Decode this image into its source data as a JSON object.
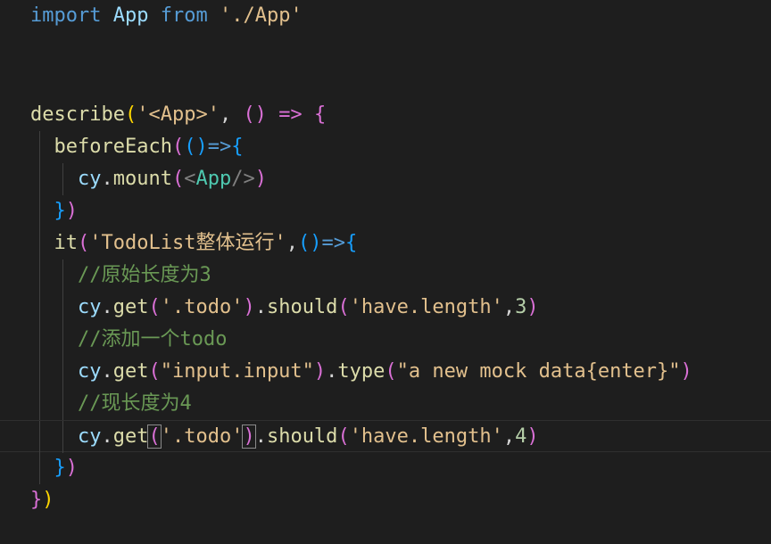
{
  "editor": {
    "lines": [
      {
        "tokens": [
          {
            "t": "import",
            "c": "kw-blue"
          },
          {
            "t": " ",
            "c": "plain"
          },
          {
            "t": "App",
            "c": "var"
          },
          {
            "t": " ",
            "c": "plain"
          },
          {
            "t": "from",
            "c": "kw-blue"
          },
          {
            "t": " ",
            "c": "plain"
          },
          {
            "t": "'./App'",
            "c": "str-main"
          }
        ]
      },
      {
        "tokens": []
      },
      {
        "tokens": []
      },
      {
        "tokens": [
          {
            "t": "describe",
            "c": "fn"
          },
          {
            "t": "(",
            "c": "b1"
          },
          {
            "t": "'<App>'",
            "c": "str-main"
          },
          {
            "t": ", ",
            "c": "plain"
          },
          {
            "t": "()",
            "c": "b2"
          },
          {
            "t": " ",
            "c": "plain"
          },
          {
            "t": "=>",
            "c": "b2"
          },
          {
            "t": " ",
            "c": "plain"
          },
          {
            "t": "{",
            "c": "b2"
          }
        ]
      },
      {
        "tokens": [
          {
            "t": "  ",
            "c": "plain"
          },
          {
            "t": "beforeEach",
            "c": "fn"
          },
          {
            "t": "(",
            "c": "b2"
          },
          {
            "t": "()",
            "c": "b3"
          },
          {
            "t": "=>",
            "c": "arrow"
          },
          {
            "t": "{",
            "c": "b3"
          }
        ]
      },
      {
        "tokens": [
          {
            "t": "    ",
            "c": "plain"
          },
          {
            "t": "cy",
            "c": "var"
          },
          {
            "t": ".",
            "c": "plain"
          },
          {
            "t": "mount",
            "c": "fn"
          },
          {
            "t": "(",
            "c": "b2"
          },
          {
            "t": "<",
            "c": "tagp"
          },
          {
            "t": "App",
            "c": "tag"
          },
          {
            "t": "/>",
            "c": "tagp"
          },
          {
            "t": ")",
            "c": "b2"
          }
        ]
      },
      {
        "tokens": [
          {
            "t": "  ",
            "c": "plain"
          },
          {
            "t": "}",
            "c": "b3"
          },
          {
            "t": ")",
            "c": "b2"
          }
        ]
      },
      {
        "tokens": [
          {
            "t": "  ",
            "c": "plain"
          },
          {
            "t": "it",
            "c": "fn"
          },
          {
            "t": "(",
            "c": "b2"
          },
          {
            "t": "'TodoList整体运行'",
            "c": "str-main"
          },
          {
            "t": ",",
            "c": "plain"
          },
          {
            "t": "()",
            "c": "b3"
          },
          {
            "t": "=>",
            "c": "arrow"
          },
          {
            "t": "{",
            "c": "b3"
          }
        ]
      },
      {
        "tokens": [
          {
            "t": "    ",
            "c": "plain"
          },
          {
            "t": "//原始长度为3",
            "c": "comment"
          }
        ]
      },
      {
        "tokens": [
          {
            "t": "    ",
            "c": "plain"
          },
          {
            "t": "cy",
            "c": "var"
          },
          {
            "t": ".",
            "c": "plain"
          },
          {
            "t": "get",
            "c": "fn"
          },
          {
            "t": "(",
            "c": "b2"
          },
          {
            "t": "'.todo'",
            "c": "str-main"
          },
          {
            "t": ")",
            "c": "b2"
          },
          {
            "t": ".",
            "c": "plain"
          },
          {
            "t": "should",
            "c": "fn"
          },
          {
            "t": "(",
            "c": "b2"
          },
          {
            "t": "'have.length'",
            "c": "str-main"
          },
          {
            "t": ",",
            "c": "plain"
          },
          {
            "t": "3",
            "c": "num"
          },
          {
            "t": ")",
            "c": "b2"
          }
        ]
      },
      {
        "tokens": [
          {
            "t": "    ",
            "c": "plain"
          },
          {
            "t": "//添加一个todo",
            "c": "comment"
          }
        ]
      },
      {
        "tokens": [
          {
            "t": "    ",
            "c": "plain"
          },
          {
            "t": "cy",
            "c": "var"
          },
          {
            "t": ".",
            "c": "plain"
          },
          {
            "t": "get",
            "c": "fn"
          },
          {
            "t": "(",
            "c": "b2"
          },
          {
            "t": "\"input.input\"",
            "c": "str-main"
          },
          {
            "t": ")",
            "c": "b2"
          },
          {
            "t": ".",
            "c": "plain"
          },
          {
            "t": "type",
            "c": "fn"
          },
          {
            "t": "(",
            "c": "b2"
          },
          {
            "t": "\"a new mock data{enter}\"",
            "c": "str-main"
          },
          {
            "t": ")",
            "c": "b2"
          }
        ]
      },
      {
        "tokens": [
          {
            "t": "    ",
            "c": "plain"
          },
          {
            "t": "//现长度为4",
            "c": "comment"
          }
        ]
      },
      {
        "tokens": [
          {
            "t": "    ",
            "c": "plain"
          },
          {
            "t": "cy",
            "c": "var"
          },
          {
            "t": ".",
            "c": "plain"
          },
          {
            "t": "get",
            "c": "fn"
          },
          {
            "t": "(",
            "c": "b2",
            "box": true
          },
          {
            "t": "'.todo'",
            "c": "str-main"
          },
          {
            "t": ")",
            "c": "b2",
            "box": true
          },
          {
            "t": ".",
            "c": "plain"
          },
          {
            "t": "should",
            "c": "fn"
          },
          {
            "t": "(",
            "c": "b2"
          },
          {
            "t": "'have.length'",
            "c": "str-main"
          },
          {
            "t": ",",
            "c": "plain"
          },
          {
            "t": "4",
            "c": "num"
          },
          {
            "t": ")",
            "c": "b2"
          }
        ],
        "active": true
      },
      {
        "tokens": [
          {
            "t": "  ",
            "c": "plain"
          },
          {
            "t": "}",
            "c": "b3"
          },
          {
            "t": ")",
            "c": "b2"
          }
        ]
      },
      {
        "tokens": [
          {
            "t": "}",
            "c": "b2"
          },
          {
            "t": ")",
            "c": "b1"
          }
        ]
      }
    ]
  }
}
